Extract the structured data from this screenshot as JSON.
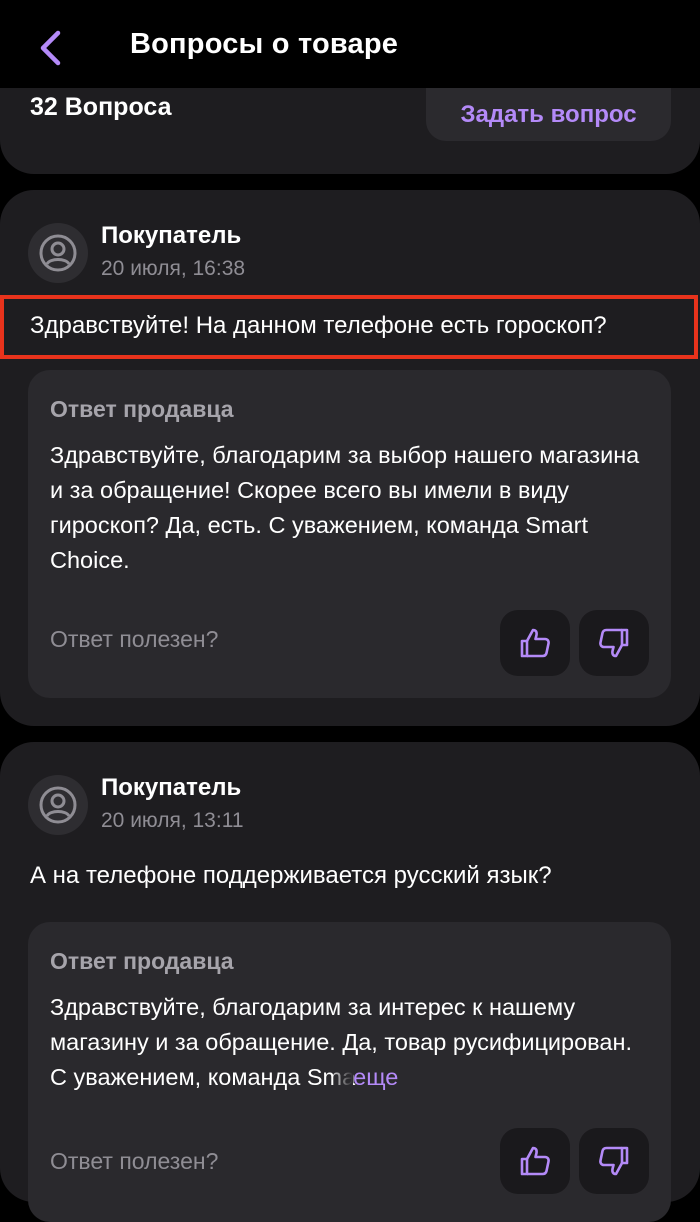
{
  "header": {
    "title": "Вопросы о товаре"
  },
  "summary": {
    "count_label": "32 Вопроса",
    "ask_button": "Задать вопрос"
  },
  "questions": [
    {
      "author": "Покупатель",
      "date": "20 июля, 16:38",
      "text": "Здравствуйте! На данном телефоне есть гороскоп?",
      "answer_label": "Ответ продавца",
      "answer_text": "Здравствуйте, благодарим за выбор нашего магазина и за обращение! Скорее всего вы имели в виду гироскоп? Да, есть. С уважением, команда Smart Choice.",
      "helpful_label": "Ответ полезен?"
    },
    {
      "author": "Покупатель",
      "date": "20 июля, 13:11",
      "text": "А на телефоне поддерживается русский язык?",
      "answer_label": "Ответ продавца",
      "answer_text": "Здравствуйте, благодарим за интерес к нашему магазину и за обращение. Да, товар русифицирован. С уважением, команда Sma",
      "more_label": "еще",
      "helpful_label": "Ответ полезен?"
    }
  ],
  "colors": {
    "accent": "#b48af8",
    "highlight": "#e8331c",
    "card": "#1e1d20"
  },
  "icons": {
    "back": "chevron-left-icon",
    "avatar": "user-circle-icon",
    "like": "thumbs-up-icon",
    "dislike": "thumbs-down-icon"
  }
}
